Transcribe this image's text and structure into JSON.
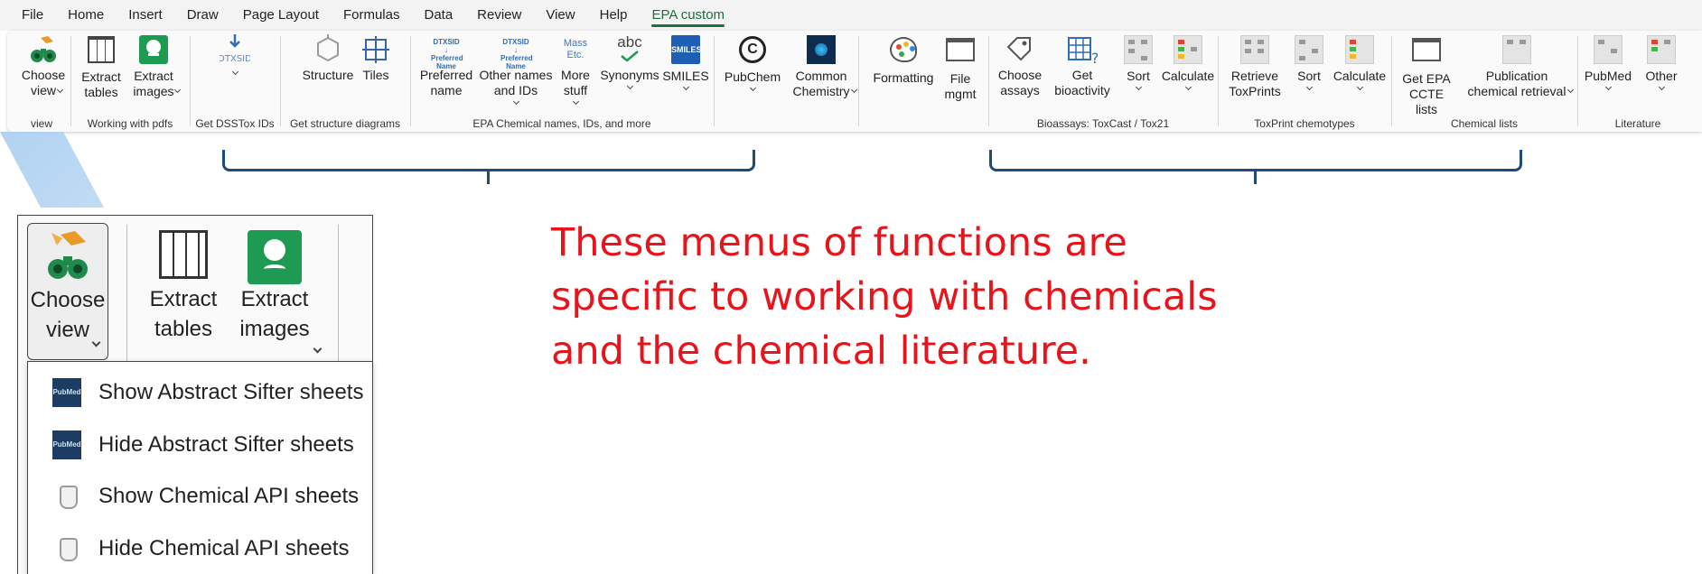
{
  "menubar": {
    "tabs": [
      "File",
      "Home",
      "Insert",
      "Draw",
      "Page Layout",
      "Formulas",
      "Data",
      "Review",
      "View",
      "Help",
      "EPA custom"
    ],
    "active_tab": "EPA custom"
  },
  "ribbon": {
    "groups": {
      "view": {
        "label": "view",
        "choose_view": "Choose\nview"
      },
      "pdfs": {
        "label": "Working with pdfs",
        "extract_tables": "Extract\ntables",
        "extract_images": "Extract\nimages"
      },
      "dsstox": {
        "label": "Get DSSTox IDs",
        "icon_text": "DTXSID"
      },
      "structure": {
        "label": "Get structure diagrams",
        "structure": "Structure",
        "tiles": "Tiles"
      },
      "names": {
        "label": "EPA Chemical names, IDs, and more",
        "preferred_name": "Preferred\nname",
        "other_names": "Other names\nand IDs",
        "more_stuff": "More\nstuff",
        "synonyms": "Synonyms",
        "smiles": "SMILES",
        "synonyms_icon_text": "abc",
        "more_icon_text": "Mass\nEtc.",
        "smiles_icon_text": "SMILES"
      },
      "external": {
        "label": "",
        "pubchem": "PubChem",
        "common_chemistry": "Common\nChemistry"
      },
      "misc": {
        "label": "",
        "formatting": "Formatting",
        "file_mgmt": "File\nmgmt"
      },
      "bioassays": {
        "label": "Bioassays: ToxCast / Tox21",
        "choose_assays": "Choose\nassays",
        "get_bioactivity": "Get\nbioactivity",
        "sort": "Sort",
        "calculate": "Calculate"
      },
      "toxprint": {
        "label": "ToxPrint chemotypes",
        "retrieve": "Retrieve\nToxPrints",
        "sort": "Sort",
        "calculate": "Calculate"
      },
      "chemical_lists": {
        "label": "Chemical lists",
        "get_epa_ccte": "Get EPA\nCCTE lists",
        "publication_retrieval": "Publication\nchemical retrieval"
      },
      "literature": {
        "label": "Literature",
        "pubmed": "PubMed",
        "other": "Other"
      }
    }
  },
  "zoom": {
    "choose_view": "Choose\nview",
    "extract_tables": "Extract\ntables",
    "extract_images": "Extract\nimages",
    "dropdown_items": [
      "Show Abstract Sifter sheets",
      "Hide Abstract Sifter sheets",
      "Show Chemical API sheets",
      "Hide Chemical API sheets"
    ],
    "pub_icon_text": "PubMed"
  },
  "headline": {
    "line1": "These menus of functions are",
    "line2": "specific to working with chemicals",
    "line3": "and the chemical literature."
  },
  "colors": {
    "accent": "#1d6f3d",
    "headline": "#e8141b",
    "bracket": "#1e4c78"
  }
}
